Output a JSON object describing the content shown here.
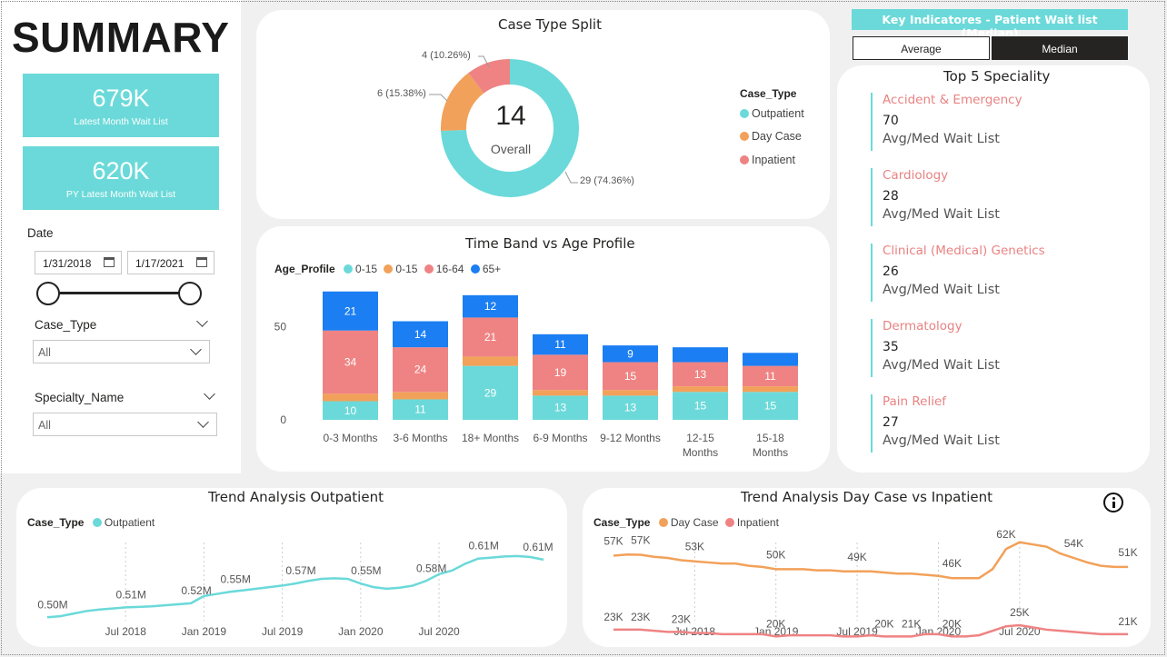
{
  "title": "SUMMARY",
  "kpis": [
    {
      "value": "679K",
      "label": "Latest Month Wait List"
    },
    {
      "value": "620K",
      "label": "PY Latest Month Wait List"
    }
  ],
  "filters": {
    "date_label": "Date",
    "date_start": "1/31/2018",
    "date_end": "1/17/2021",
    "case_type_label": "Case_Type",
    "case_type_value": "All",
    "specialty_label": "Specialty_Name",
    "specialty_value": "All"
  },
  "colors": {
    "outpatient": "#6bd9d9",
    "day_case": "#f2a15a",
    "inpatient": "#ef8383",
    "age_65": "#1b7ef2",
    "accent": "#6bd9d9"
  },
  "key_indicators": {
    "header": "Key Indicatores - Patient Wait list (Median)",
    "toggle_average": "Average",
    "toggle_median": "Median",
    "selected": "Median"
  },
  "top_specialty": {
    "title": "Top 5 Speciality",
    "items": [
      {
        "name": "Accident & Emergency",
        "value": "70",
        "sub": "Avg/Med Wait List"
      },
      {
        "name": "Cardiology",
        "value": "28",
        "sub": "Avg/Med Wait List"
      },
      {
        "name": "Clinical (Medical) Genetics",
        "value": "26",
        "sub": "Avg/Med Wait List"
      },
      {
        "name": "Dermatology",
        "value": "35",
        "sub": "Avg/Med Wait List"
      },
      {
        "name": "Pain Relief",
        "value": "27",
        "sub": "Avg/Med Wait List"
      }
    ]
  },
  "chart_data": [
    {
      "type": "pie",
      "title": "Case Type Split",
      "center_value": "14",
      "center_label": "Overall",
      "legend_title": "Case_Type",
      "slices": [
        {
          "name": "Outpatient",
          "value": 29,
          "label": "29 (74.36%)"
        },
        {
          "name": "Day Case",
          "value": 6,
          "label": "6 (15.38%)"
        },
        {
          "name": "Inpatient",
          "value": 4,
          "label": "4 (10.26%)"
        }
      ]
    },
    {
      "type": "bar",
      "title": "Time Band vs Age Profile",
      "legend_title": "Age_Profile",
      "categories": [
        "0-3 Months",
        "3-6 Months",
        "18+ Months",
        "6-9 Months",
        "9-12 Months",
        "12-15 Months",
        "15-18 Months"
      ],
      "series": [
        {
          "name": "0-15",
          "values": [
            10,
            11,
            29,
            13,
            13,
            15,
            15
          ]
        },
        {
          "name": "0-15",
          "values": [
            4,
            4,
            5,
            3,
            3,
            3,
            3
          ]
        },
        {
          "name": "16-64",
          "values": [
            34,
            24,
            21,
            19,
            15,
            13,
            11
          ]
        },
        {
          "name": "65+",
          "values": [
            21,
            14,
            12,
            11,
            9,
            8,
            7
          ]
        }
      ],
      "segment_labels": [
        [
          "10",
          "11",
          "29",
          "13",
          "13",
          "15",
          "15"
        ],
        [
          "",
          "",
          "",
          "",
          "",
          "",
          ""
        ],
        [
          "34",
          "24",
          "21",
          "19",
          "15",
          "13",
          "11"
        ],
        [
          "21",
          "14",
          "12",
          "11",
          "9",
          "",
          ""
        ]
      ],
      "yticks": [
        "0",
        "50"
      ],
      "ylim": [
        0,
        70
      ]
    },
    {
      "type": "line",
      "title": "Trend Analysis Outpatient",
      "legend_title": "Case_Type",
      "series": [
        {
          "name": "Outpatient",
          "values": [
            0.495,
            0.497,
            0.502,
            0.507,
            0.51,
            0.512,
            0.514,
            0.515,
            0.516,
            0.518,
            0.52,
            0.522,
            0.536,
            0.54,
            0.544,
            0.547,
            0.55,
            0.553,
            0.556,
            0.56,
            0.565,
            0.569,
            0.57,
            0.569,
            0.56,
            0.553,
            0.55,
            0.552,
            0.556,
            0.565,
            0.578,
            0.585,
            0.598,
            0.608,
            0.61,
            0.612,
            0.613,
            0.611,
            0.606
          ]
        }
      ],
      "x_start": "2018-01",
      "x_end": "2021-03",
      "xticks": [
        "Jul 2018",
        "Jan 2019",
        "Jul 2019",
        "Jan 2020",
        "Jul 2020"
      ],
      "point_labels": [
        "0.50M",
        "0.51M",
        "0.52M",
        "0.55M",
        "0.57M",
        "0.55M",
        "0.58M",
        "0.61M",
        "0.61M"
      ],
      "ylim": [
        0.45,
        0.66
      ]
    },
    {
      "type": "line",
      "title": "Trend Analysis Day Case vs Inpatient",
      "legend_title": "Case_Type",
      "series": [
        {
          "name": "Day Case",
          "values": [
            56,
            56.5,
            56.4,
            55.5,
            55,
            54,
            53.5,
            53,
            52.5,
            52.5,
            51.5,
            51,
            50,
            50,
            50,
            49.5,
            49.5,
            49,
            49,
            49,
            48.5,
            48,
            48,
            47.5,
            47,
            46,
            46,
            46,
            50,
            59,
            62,
            61,
            60,
            57,
            55,
            53,
            51.5,
            51,
            51
          ]
        },
        {
          "name": "Inpatient",
          "values": [
            23,
            23,
            23,
            22.5,
            22,
            22,
            21.5,
            21.5,
            21,
            21,
            21,
            21,
            20,
            20.5,
            20.5,
            20.5,
            20.5,
            20,
            20,
            20.5,
            20,
            20,
            20,
            21,
            21,
            20,
            20,
            20.5,
            22.5,
            24.5,
            25,
            24,
            23,
            22.5,
            22,
            21.5,
            21,
            21,
            21
          ]
        }
      ],
      "x_start": "2018-01",
      "x_end": "2021-03",
      "xticks": [
        "Jul 2018",
        "Jan 2019",
        "Jul 2019",
        "Jan 2020",
        "Jul 2020"
      ],
      "day_case_labels": [
        "57K",
        "57K",
        "53K",
        "50K",
        "49K",
        "46K",
        "62K",
        "54K",
        "51K"
      ],
      "inpatient_labels": [
        "23K",
        "23K",
        "23K",
        "20K",
        "20K",
        "21K",
        "20K",
        "25K",
        "21K"
      ],
      "ylim": [
        10,
        70
      ]
    }
  ]
}
